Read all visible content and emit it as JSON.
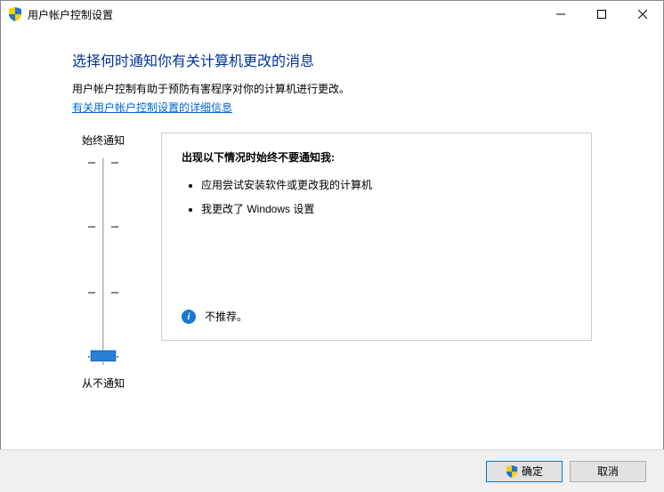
{
  "window": {
    "title": "用户帐户控制设置"
  },
  "heading": "选择何时通知你有关计算机更改的消息",
  "subtitle": "用户帐户控制有助于预防有害程序对你的计算机进行更改。",
  "link": "有关用户帐户控制设置的详细信息",
  "slider": {
    "top_label": "始终通知",
    "bottom_label": "从不通知"
  },
  "panel": {
    "title": "出现以下情况时始终不要通知我:",
    "items": [
      "应用尝试安装软件或更改我的计算机",
      "我更改了 Windows 设置"
    ],
    "recommendation": "不推荐。"
  },
  "buttons": {
    "ok": "确定",
    "cancel": "取消"
  }
}
